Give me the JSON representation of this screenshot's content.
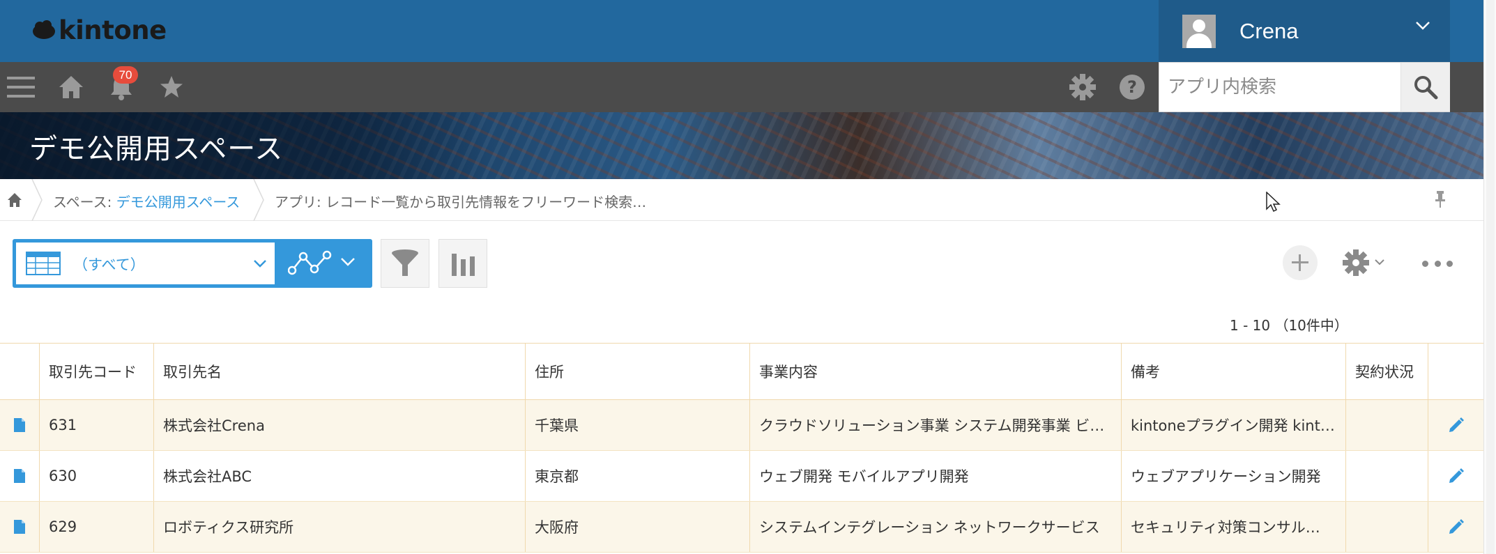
{
  "header": {
    "logo_text": "kintone",
    "user_name": "Crena",
    "notification_count": "70",
    "search_placeholder": "アプリ内検索"
  },
  "banner": {
    "space_title": "デモ公開用スペース"
  },
  "breadcrumb": {
    "space_prefix": "スペース: ",
    "space_name": "デモ公開用スペース",
    "app_text": "アプリ: レコード一覧から取引先情報をフリーワード検索…"
  },
  "toolbar": {
    "view_label": "（すべて）"
  },
  "pager": {
    "text": "1 - 10 （10件中）"
  },
  "table": {
    "columns": [
      "取引先コード",
      "取引先名",
      "住所",
      "事業内容",
      "備考",
      "契約状況"
    ],
    "rows": [
      {
        "code": "631",
        "name": "株式会社Crena",
        "address": "千葉県",
        "business": "クラウドソリューション事業 システム開発事業 ビ…",
        "note": "kintoneプラグイン開発 kint…",
        "status": ""
      },
      {
        "code": "630",
        "name": "株式会社ABC",
        "address": "東京都",
        "business": "ウェブ開発 モバイルアプリ開発",
        "note": "ウェブアプリケーション開発",
        "status": ""
      },
      {
        "code": "629",
        "name": "ロボティクス研究所",
        "address": "大阪府",
        "business": "システムインテグレーション ネットワークサービス",
        "note": "セキュリティ対策コンサル…",
        "status": ""
      }
    ]
  },
  "colors": {
    "header_blue": "#22689e",
    "nav_dark": "#4b4b4b",
    "accent_blue": "#3498db",
    "row_alt": "#fbf6e9",
    "badge_red": "#e74c3c"
  },
  "icons": [
    "menu-icon",
    "home-icon",
    "bell-icon",
    "star-icon",
    "gear-icon",
    "help-icon",
    "search-icon",
    "pin-icon",
    "table-view-icon",
    "graph-icon",
    "filter-icon",
    "chart-icon",
    "plus-icon",
    "record-detail-icon",
    "edit-pencil-icon"
  ]
}
